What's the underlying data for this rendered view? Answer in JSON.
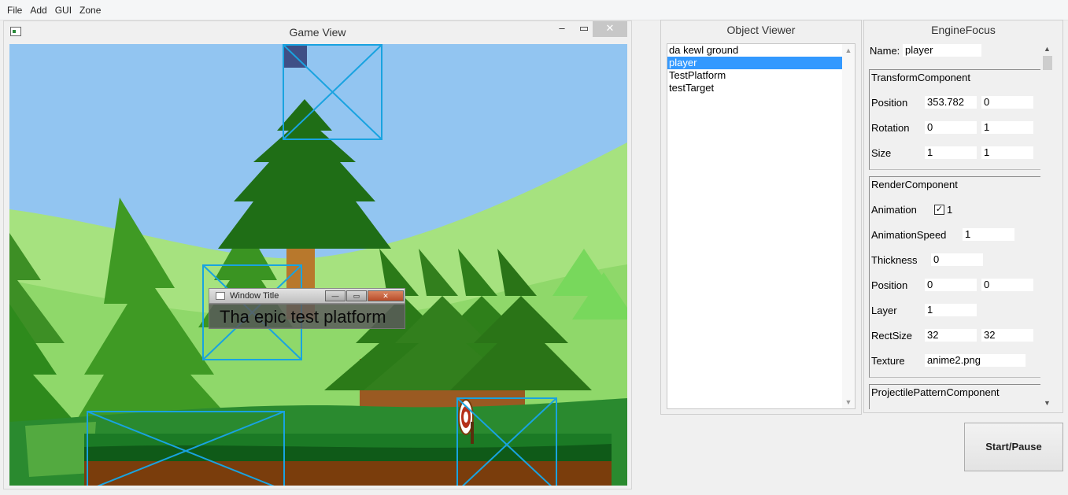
{
  "menubar": {
    "items": [
      "File",
      "Add",
      "GUI",
      "Zone"
    ]
  },
  "game_view": {
    "title": "Game View",
    "min_label": "–",
    "max_label": "▭",
    "close_label": "✕",
    "mini_window": {
      "title": "Window Title",
      "min_label": "—",
      "max_label": "▭",
      "close_label": "✕",
      "text": "Tha epic test platform"
    }
  },
  "object_viewer": {
    "title": "Object Viewer",
    "items": [
      "da kewl ground",
      "player",
      "TestPlatform",
      "testTarget"
    ],
    "selected": "player"
  },
  "engine_focus": {
    "title": "EngineFocus",
    "name_label": "Name:",
    "name_value": "player",
    "transform": {
      "header": "TransformComponent",
      "position_label": "Position",
      "position_x": "353.782",
      "position_y": "0",
      "rotation_label": "Rotation",
      "rotation_a": "0",
      "rotation_b": "1",
      "size_label": "Size",
      "size_x": "1",
      "size_y": "1"
    },
    "render": {
      "header": "RenderComponent",
      "animation_label": "Animation",
      "animation_checked": "✓",
      "animation_value": "1",
      "animation_speed_label": "AnimationSpeed",
      "animation_speed": "1",
      "thickness_label": "Thickness",
      "thickness": "0",
      "position_label": "Position",
      "position_x": "0",
      "position_y": "0",
      "layer_label": "Layer",
      "layer": "1",
      "rectsize_label": "RectSize",
      "rectsize_x": "32",
      "rectsize_y": "32",
      "texture_label": "Texture",
      "texture": "anime2.png"
    },
    "projectile": {
      "header": "ProjectilePatternComponent"
    }
  },
  "start_button": {
    "label": "Start/Pause"
  },
  "colors": {
    "sky": "#92c5f1",
    "hill_light": "#a6e27f",
    "tree_dark": "#2e7d1c",
    "ground": "#1f7a2a",
    "dirt": "#7a3d0c",
    "debug_box": "#19a3e0",
    "selection": "#3399ff"
  }
}
